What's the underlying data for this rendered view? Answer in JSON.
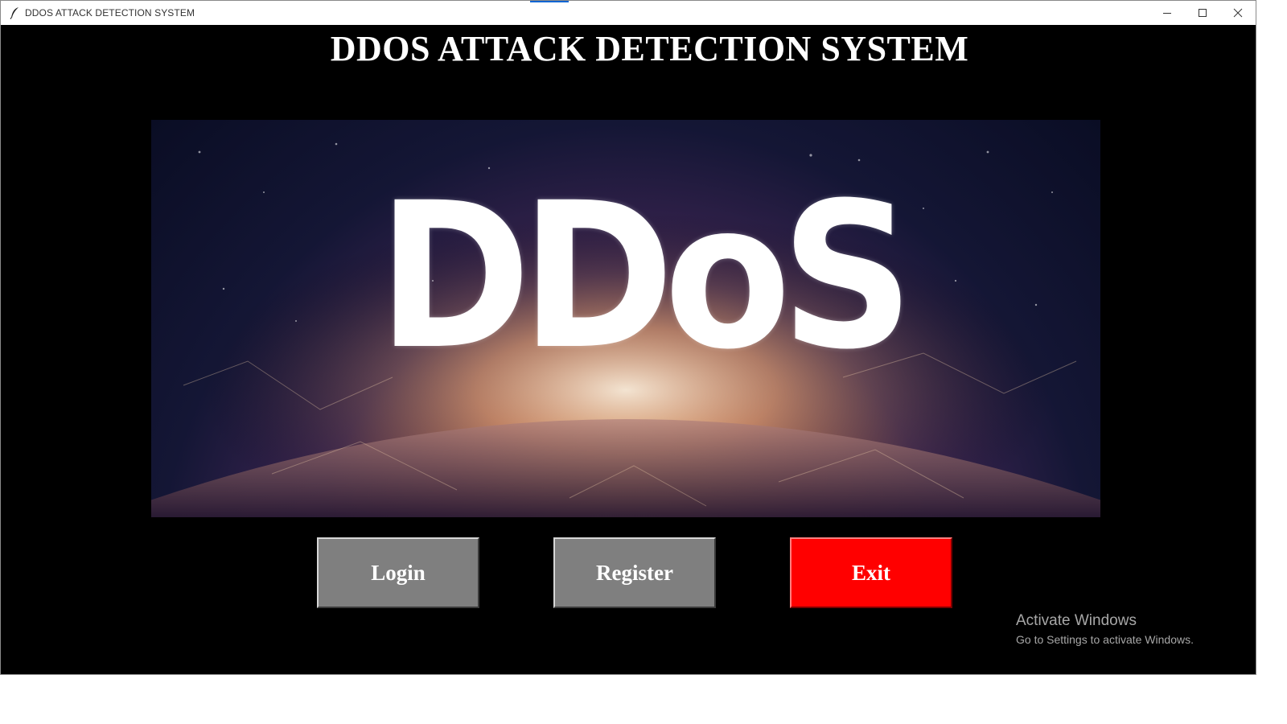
{
  "window": {
    "title": "DDOS ATTACK DETECTION SYSTEM",
    "controls": {
      "minimize": "minimize-icon",
      "maximize": "maximize-icon",
      "close": "close-icon"
    }
  },
  "app": {
    "heading": "DDOS ATTACK DETECTION SYSTEM",
    "banner_text": "DDoS"
  },
  "buttons": {
    "login": "Login",
    "register": "Register",
    "exit": "Exit"
  },
  "colors": {
    "background": "#000000",
    "button_gray": "#7f7f7f",
    "button_exit": "#ff0000",
    "text": "#ffffff"
  },
  "watermark": {
    "title": "Activate Windows",
    "subtitle": "Go to Settings to activate Windows."
  }
}
